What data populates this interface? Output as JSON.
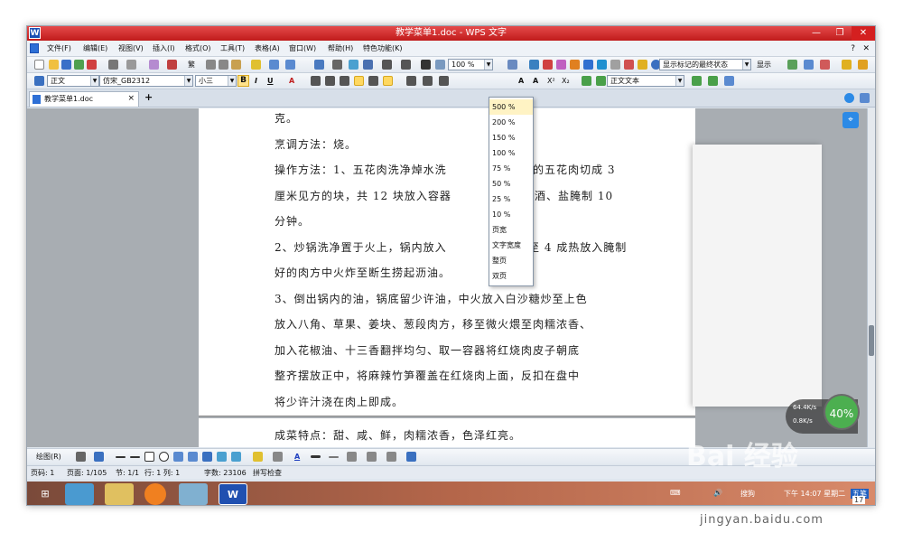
{
  "window": {
    "title": "教学菜单1.doc - WPS 文字",
    "app_icon": "W"
  },
  "menubar": {
    "items": [
      "文件(F)",
      "编辑(E)",
      "视图(V)",
      "插入(I)",
      "格式(O)",
      "工具(T)",
      "表格(A)",
      "窗口(W)",
      "帮助(H)",
      "特色功能(K)"
    ]
  },
  "toolbar1": {
    "zoom_value": "100 %",
    "markup_mode": "显示标记的最终状态",
    "show_label": "显示"
  },
  "toolbar2": {
    "style_value": "正文",
    "font_value": "仿宋_GB2312",
    "size_value": "小三",
    "bold_label": "B",
    "italic_label": "I",
    "underline_label": "U",
    "text_style_value": "正文文本"
  },
  "tab": {
    "label": "教学菜单1.doc",
    "close": "×",
    "add": "+"
  },
  "document": {
    "lines": [
      "克。",
      "烹调方法：烧。",
      "操作方法：1、五花肉洗净焯水洗",
      "净后的五花肉切成 3",
      "厘米见方的块，共 12 块放入容器",
      "入料酒、盐腌制 10",
      "分钟。",
      "2、炒锅洗净置于火上，锅内放入",
      "烧至 4 成热放入腌制",
      "好的肉方中火炸至断生捞起沥油。",
      "3、倒出锅内的油，锅底留少许油，中火放入白沙糖炒至上色",
      "放入八角、草果、姜块、葱段肉方，移至微火煨至肉糯浓香、",
      "加入花椒油、十三香翻拌均匀、取一容器将红烧肉皮子朝底",
      "整齐摆放正中，将麻辣竹笋覆盖在红烧肉上面，反扣在盘中",
      "将少许汁浇在肉上即成。",
      "成菜特点：甜、咸、鲜，肉糯浓香，色泽红亮。"
    ]
  },
  "zoom_dropdown": {
    "options": [
      "500 %",
      "200 %",
      "150 %",
      "100 %",
      "75 %",
      "50 %",
      "25 %",
      "10 %",
      "页宽",
      "文字宽度",
      "整页",
      "双页"
    ],
    "selected": "500 %"
  },
  "net_widget": {
    "up": "64.4K/s",
    "down": "0.8K/s",
    "percent": "40%"
  },
  "draw_toolbar": {
    "label": "绘图(R)"
  },
  "statusbar": {
    "page_code": "页码: 1",
    "page": "页面: 1/105",
    "section": "节: 1/1",
    "row_col": "行: 1  列: 1",
    "chars": "字数: 23106",
    "spell": "拼写检查"
  },
  "taskbar": {
    "time": "下午 14:07 星期二",
    "ime": "搜狗",
    "date_badge": "17",
    "tray_label": "五笔"
  },
  "watermark": {
    "brand": "Bai 经验",
    "url": "jingyan.baidu.com"
  }
}
